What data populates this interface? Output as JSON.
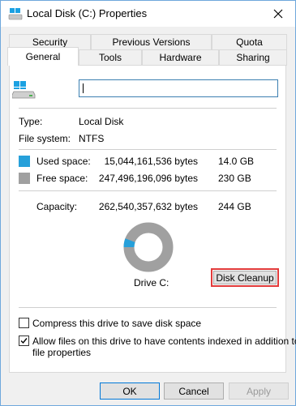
{
  "window": {
    "title": "Local Disk (C:) Properties"
  },
  "tabs": {
    "row1": [
      "Security",
      "Previous Versions",
      "Quota"
    ],
    "row2": [
      "General",
      "Tools",
      "Hardware",
      "Sharing"
    ],
    "active": "General"
  },
  "general": {
    "name_value": "",
    "type_label": "Type:",
    "type_value": "Local Disk",
    "fs_label": "File system:",
    "fs_value": "NTFS",
    "used": {
      "label": "Used space:",
      "bytes": "15,044,161,536 bytes",
      "size": "14.0 GB",
      "color": "#26a0da"
    },
    "free": {
      "label": "Free space:",
      "bytes": "247,496,196,096 bytes",
      "size": "230 GB",
      "color": "#a0a0a0"
    },
    "capacity": {
      "label": "Capacity:",
      "bytes": "262,540,357,632 bytes",
      "size": "244 GB"
    },
    "used_fraction": 0.057,
    "drive_label": "Drive C:",
    "cleanup_label": "Disk Cleanup",
    "compress": {
      "label": "Compress this drive to save disk space",
      "checked": false
    },
    "index": {
      "label_line1": "Allow files on this drive to have contents indexed in addition to",
      "label_line2": "file properties",
      "checked": true
    }
  },
  "buttons": {
    "ok": "OK",
    "cancel": "Cancel",
    "apply": "Apply"
  },
  "icons": [
    "drive-icon",
    "close-icon",
    "checkmark-icon"
  ]
}
